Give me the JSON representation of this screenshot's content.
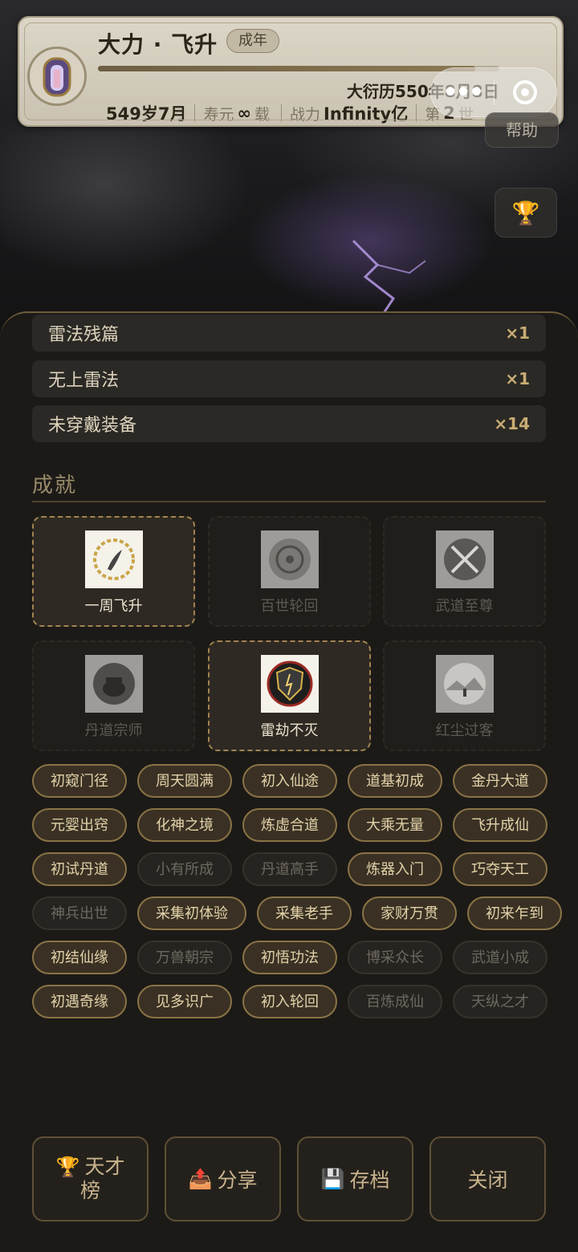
{
  "header": {
    "name": "大力 · 飞升",
    "stage_badge": "成年",
    "progress": 0.94,
    "date": "大衍历550年8月8日",
    "age": "549岁7月",
    "lifespan_label": "寿元",
    "lifespan_value": "∞",
    "lifespan_unit": "载",
    "power_label": "战力",
    "power_value": "Infinity亿",
    "life_prefix": "第",
    "life_num": "2",
    "life_suffix": "世"
  },
  "controls": {
    "menu_dots": "•••",
    "help": "帮助",
    "trophy_icon": "🏆"
  },
  "items": [
    {
      "label": "雷法残篇",
      "count": "×1"
    },
    {
      "label": "无上雷法",
      "count": "×1"
    },
    {
      "label": "未穿戴装备",
      "count": "×14"
    }
  ],
  "achievements_title": "成就",
  "achievement_cards": [
    {
      "name": "一周飞升",
      "unlocked": true
    },
    {
      "name": "百世轮回",
      "unlocked": false
    },
    {
      "name": "武道至尊",
      "unlocked": false
    },
    {
      "name": "丹道宗师",
      "unlocked": false
    },
    {
      "name": "雷劫不灭",
      "unlocked": true
    },
    {
      "name": "红尘过客",
      "unlocked": false
    }
  ],
  "tags": [
    {
      "label": "初窥门径",
      "on": true
    },
    {
      "label": "周天圆满",
      "on": true
    },
    {
      "label": "初入仙途",
      "on": true
    },
    {
      "label": "道基初成",
      "on": true
    },
    {
      "label": "金丹大道",
      "on": true
    },
    {
      "label": "元婴出窍",
      "on": true
    },
    {
      "label": "化神之境",
      "on": true
    },
    {
      "label": "炼虚合道",
      "on": true
    },
    {
      "label": "大乘无量",
      "on": true
    },
    {
      "label": "飞升成仙",
      "on": true
    },
    {
      "label": "初试丹道",
      "on": true
    },
    {
      "label": "小有所成",
      "on": false
    },
    {
      "label": "丹道高手",
      "on": false
    },
    {
      "label": "炼器入门",
      "on": true
    },
    {
      "label": "巧夺天工",
      "on": true
    },
    {
      "label": "神兵出世",
      "on": false
    },
    {
      "label": "采集初体验",
      "on": true
    },
    {
      "label": "采集老手",
      "on": true
    },
    {
      "label": "家财万贯",
      "on": true
    },
    {
      "label": "初来乍到",
      "on": true
    },
    {
      "label": "初结仙缘",
      "on": true
    },
    {
      "label": "万兽朝宗",
      "on": false
    },
    {
      "label": "初悟功法",
      "on": true
    },
    {
      "label": "博采众长",
      "on": false
    },
    {
      "label": "武道小成",
      "on": false
    },
    {
      "label": "初遇奇缘",
      "on": true
    },
    {
      "label": "见多识广",
      "on": true
    },
    {
      "label": "初入轮回",
      "on": true
    },
    {
      "label": "百炼成仙",
      "on": false
    },
    {
      "label": "天纵之才",
      "on": false
    }
  ],
  "buttons": {
    "leaderboard_line1": "天才",
    "leaderboard_line2": "榜",
    "leaderboard_icon": "🏆",
    "share": "分享",
    "share_icon": "📤",
    "save": "存档",
    "save_icon": "💾",
    "close": "关闭"
  }
}
